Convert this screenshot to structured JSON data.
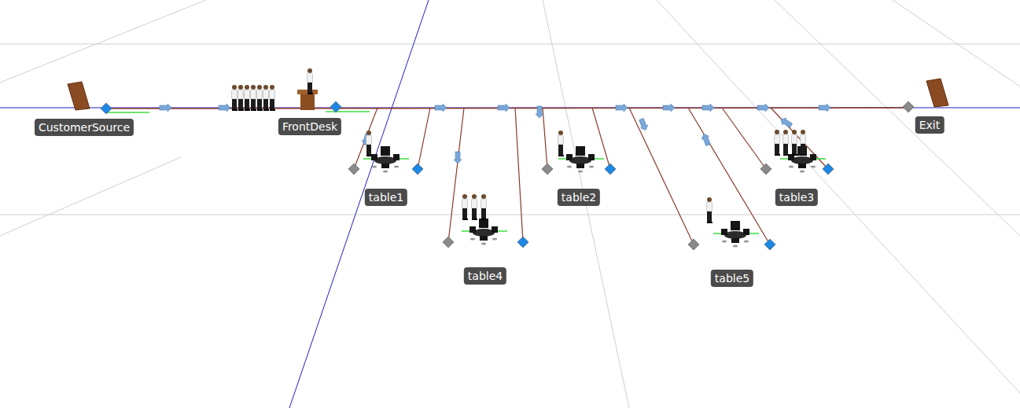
{
  "view": {
    "kind": "3d-simulation-model"
  },
  "nodes": [
    {
      "label": "CustomerSource",
      "kind": "source",
      "people": 0
    },
    {
      "label": "FrontDesk",
      "kind": "queue",
      "people": 7
    },
    {
      "label": "table1",
      "kind": "table",
      "people": 1
    },
    {
      "label": "table4",
      "kind": "table",
      "people": 3
    },
    {
      "label": "table2",
      "kind": "table",
      "people": 1
    },
    {
      "label": "table5",
      "kind": "table",
      "people": 1
    },
    {
      "label": "table3",
      "kind": "table",
      "people": 4
    },
    {
      "label": "Exit",
      "kind": "sink",
      "people": 0
    }
  ]
}
